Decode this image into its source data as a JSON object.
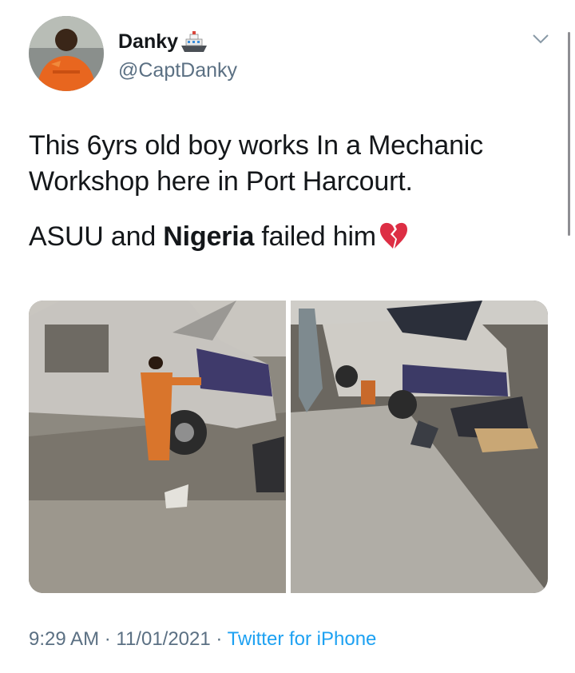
{
  "user": {
    "display_name": "Danky",
    "name_emoji": "ship-icon",
    "handle": "@CaptDanky"
  },
  "tweet": {
    "line1": "This 6yrs old boy works In a Mechanic Workshop here in Port Harcourt.",
    "line2_prefix": "ASUU and ",
    "line2_bold": "Nigeria",
    "line2_suffix": " failed him",
    "line2_emoji": "broken-heart-icon"
  },
  "meta": {
    "time": "9:29 AM",
    "sep1": " · ",
    "date": "11/01/2021",
    "sep2": " · ",
    "source": "Twitter for iPhone"
  },
  "colors": {
    "link": "#1da1f2",
    "secondary": "#5b7083",
    "text": "#14171a"
  }
}
